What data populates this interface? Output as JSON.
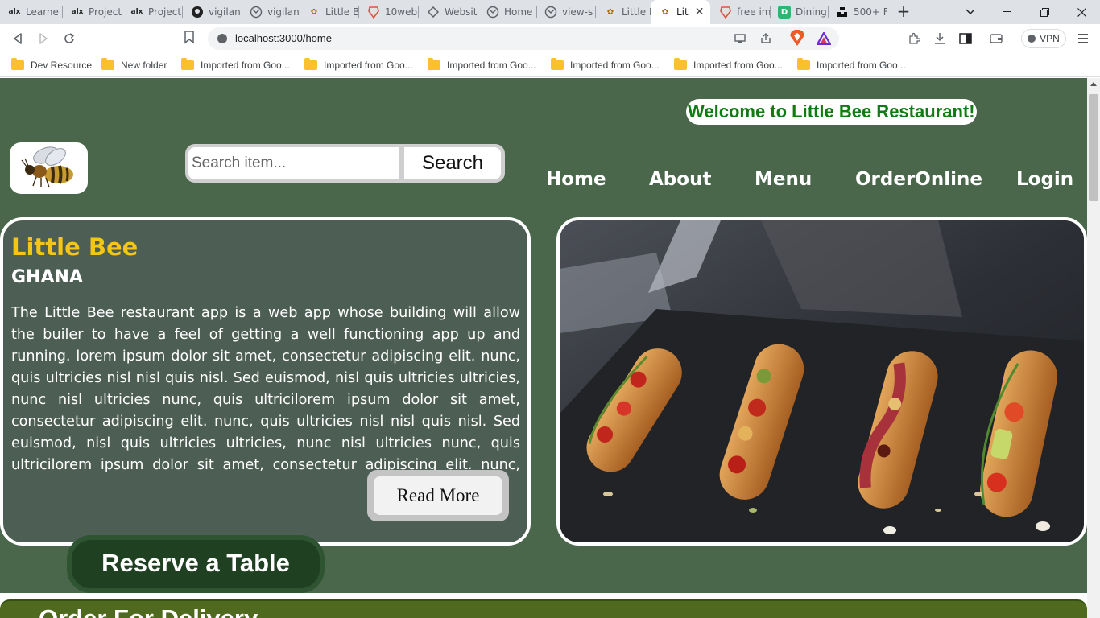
{
  "browser": {
    "tabs": [
      {
        "icon": "alx",
        "label": "Learne"
      },
      {
        "icon": "alx",
        "label": "Project"
      },
      {
        "icon": "alx",
        "label": "Project"
      },
      {
        "icon": "github",
        "label": "vigilan"
      },
      {
        "icon": "globe",
        "label": "vigilan"
      },
      {
        "icon": "bee",
        "label": "Little B"
      },
      {
        "icon": "brave",
        "label": "10web"
      },
      {
        "icon": "diamond",
        "label": "Websit"
      },
      {
        "icon": "globe",
        "label": "Home"
      },
      {
        "icon": "globe",
        "label": "view-s"
      },
      {
        "icon": "bee",
        "label": "Little B"
      },
      {
        "icon": "bee",
        "label": "Lit",
        "active": true
      },
      {
        "icon": "brave",
        "label": "free im"
      },
      {
        "icon": "D",
        "label": "Dining"
      },
      {
        "icon": "unsplash",
        "label": "500+ F"
      }
    ],
    "url": "localhost:3000/home",
    "vpn_label": "VPN",
    "bookmarks": [
      "Dev Resource",
      "New folder",
      "Imported from Goo...",
      "Imported from Goo...",
      "Imported from Goo...",
      "Imported from Goo...",
      "Imported from Goo...",
      "Imported from Goo..."
    ]
  },
  "page": {
    "welcome": "Welcome to Little Bee Restaurant!",
    "search": {
      "placeholder": "Search item...",
      "button": "Search"
    },
    "nav": [
      "Home",
      "About",
      "Menu",
      "OrderOnline",
      "Login"
    ],
    "brand": {
      "title": "Little Bee",
      "subtitle": "GHANA",
      "description": "The Little Bee restaurant app is a web app whose building will allow the builer to have a feel of getting a well functioning app up and running. lorem ipsum dolor sit amet, consectetur adipiscing elit. nunc, quis ultricies nisl nisl quis nisl. Sed euismod, nisl quis ultricies ultricies, nunc nisl ultricies nunc, quis ultricilorem ipsum dolor sit amet, consectetur adipiscing elit. nunc, quis ultricies nisl nisl quis nisl. Sed euismod, nisl quis ultricies ultricies, nunc nisl ultricies nunc, quis ultricilorem ipsum dolor sit amet, consectetur adipiscing elit. nunc, quis ultricies...",
      "read_more": "Read More"
    },
    "reserve_button": "Reserve a Table",
    "delivery_title": "Order For Delivery"
  },
  "colors": {
    "hero_bg": "#4a664b",
    "brand_yellow": "#f5c518",
    "welcome_green": "#117a13",
    "delivery_bg": "#4f6a1e"
  }
}
